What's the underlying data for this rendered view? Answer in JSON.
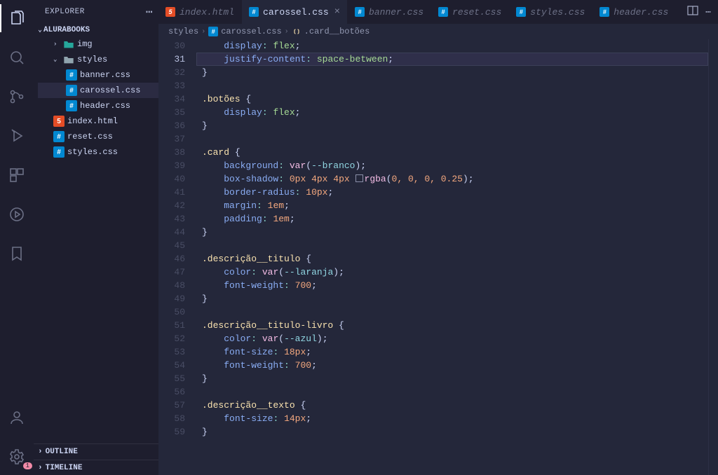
{
  "sidebar": {
    "title": "EXPLORER",
    "project": "ALURABOOKS",
    "folders": {
      "img": "img",
      "styles": "styles"
    },
    "files": {
      "banner": "banner.css",
      "carossel": "carossel.css",
      "header": "header.css",
      "index": "index.html",
      "reset": "reset.css",
      "stylescss": "styles.css"
    },
    "outline": "OUTLINE",
    "timeline": "TIMELINE"
  },
  "tabs": {
    "index": "index.html",
    "carossel": "carossel.css",
    "banner": "banner.css",
    "reset": "reset.css",
    "styles": "styles.css",
    "header": "header.css"
  },
  "breadcrumbs": {
    "c0": "styles",
    "c1": "carossel.css",
    "c2": ".card__botões"
  },
  "gutter": [
    "30",
    "31",
    "32",
    "33",
    "34",
    "35",
    "36",
    "37",
    "38",
    "39",
    "40",
    "41",
    "42",
    "43",
    "44",
    "45",
    "46",
    "47",
    "48",
    "49",
    "50",
    "51",
    "52",
    "53",
    "54",
    "55",
    "56",
    "57",
    "58",
    "59"
  ],
  "code": {
    "l30": {
      "prop": "display",
      "val": "flex"
    },
    "l31": {
      "prop": "justify-content",
      "val": "space-between"
    },
    "l34": {
      "sel": ".botões"
    },
    "l35": {
      "prop": "display",
      "val": "flex"
    },
    "l38": {
      "sel": ".card"
    },
    "l39": {
      "prop": "background",
      "fn": "var",
      "arg": "--branco"
    },
    "l40": {
      "prop": "box-shadow",
      "n1": "0px",
      "n2": "4px",
      "n3": "4px",
      "fn": "rgba",
      "args": "0, 0, 0, 0.25"
    },
    "l41": {
      "prop": "border-radius",
      "val": "10px"
    },
    "l42": {
      "prop": "margin",
      "val": "1em"
    },
    "l43": {
      "prop": "padding",
      "val": "1em"
    },
    "l46": {
      "sel": ".descrição__titulo"
    },
    "l47": {
      "prop": "color",
      "fn": "var",
      "arg": "--laranja"
    },
    "l48": {
      "prop": "font-weight",
      "val": "700"
    },
    "l51": {
      "sel": ".descrição__titulo-livro"
    },
    "l52": {
      "prop": "color",
      "fn": "var",
      "arg": "--azul"
    },
    "l53": {
      "prop": "font-size",
      "val": "18px"
    },
    "l54": {
      "prop": "font-weight",
      "val": "700"
    },
    "l57": {
      "sel": ".descrição__texto"
    },
    "l58": {
      "prop": "font-size",
      "val": "14px"
    }
  },
  "settings_badge": "1"
}
